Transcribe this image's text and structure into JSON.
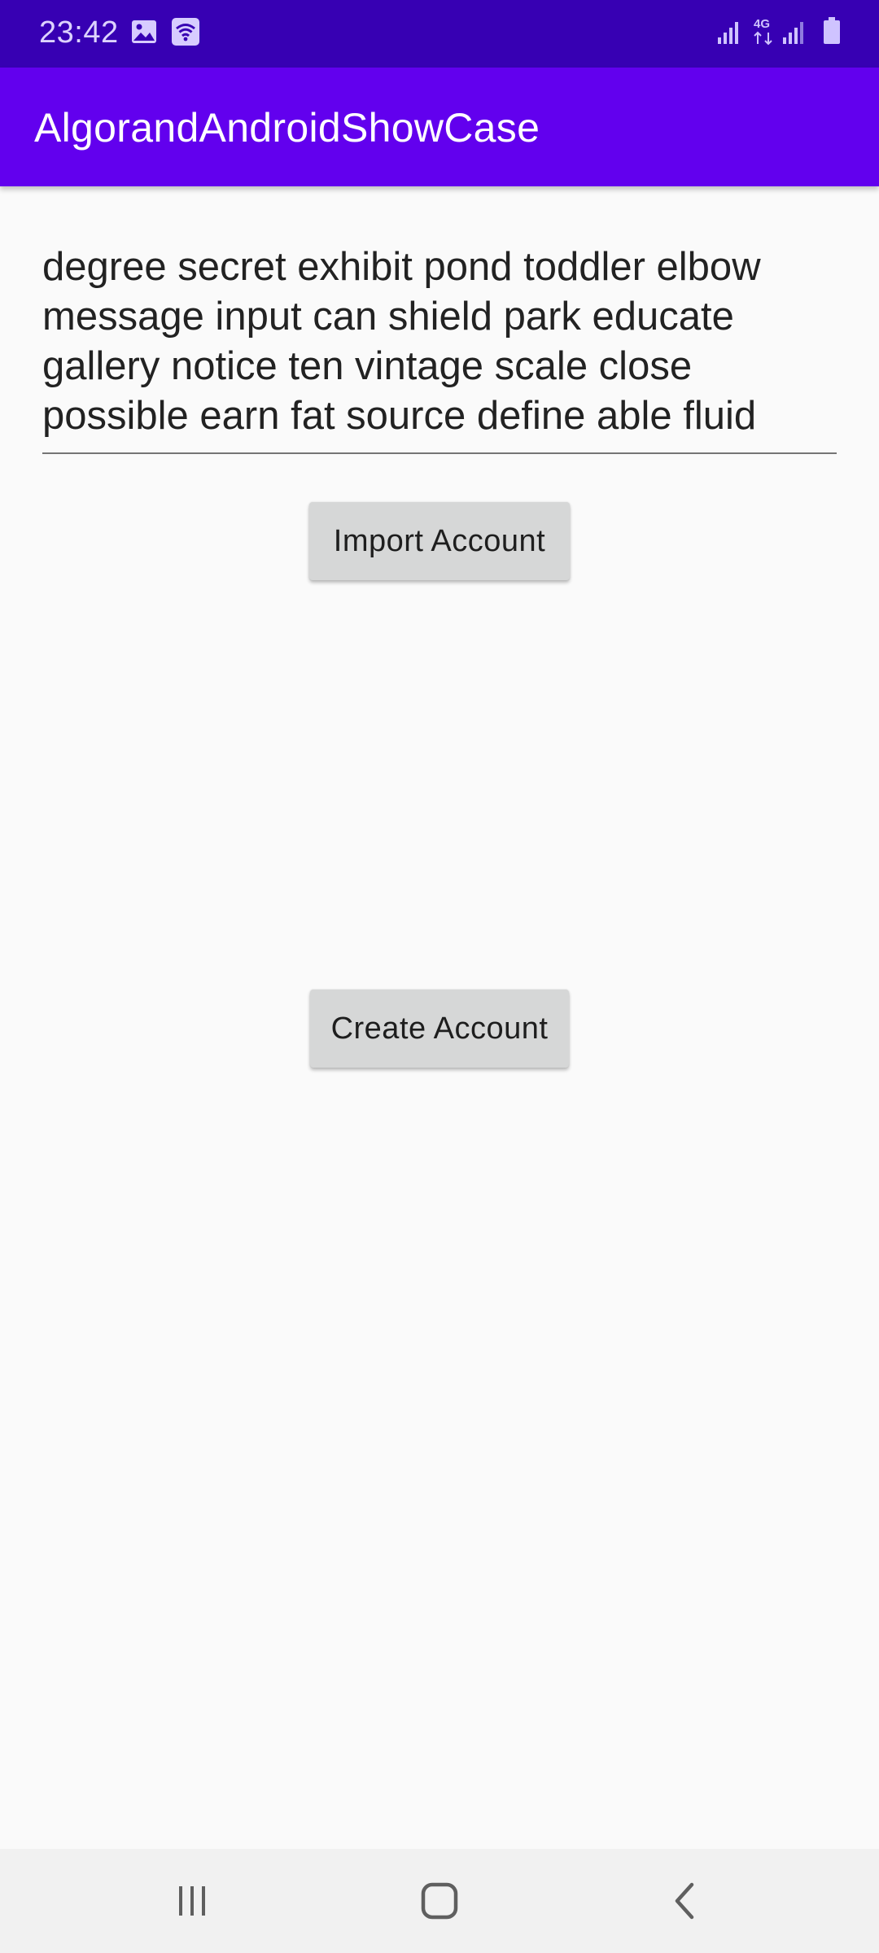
{
  "status_bar": {
    "time": "23:42",
    "icons": {
      "left": [
        "image-notification-icon",
        "wifi-icon"
      ],
      "right": [
        "signal-strength-icon",
        "network-4g-icon",
        "signal-strength-2-icon",
        "battery-icon"
      ]
    },
    "network_label": "4G"
  },
  "app_bar": {
    "title": "AlgorandAndroidShowCase",
    "color": "#6200ee"
  },
  "mnemonic": {
    "value": "degree secret exhibit pond toddler elbow\nmessage input can shield park educate\ngallery notice ten vintage scale close\npossible earn fat source define able fluid"
  },
  "buttons": {
    "import_label": "Import Account",
    "create_label": "Create Account"
  },
  "nav_bar": {
    "icons": [
      "recent-apps-icon",
      "home-icon",
      "back-icon"
    ]
  },
  "colors": {
    "status_bar": "#3700b3",
    "app_bar": "#6200ee",
    "background": "#fafafa",
    "button": "#d6d7d7"
  }
}
